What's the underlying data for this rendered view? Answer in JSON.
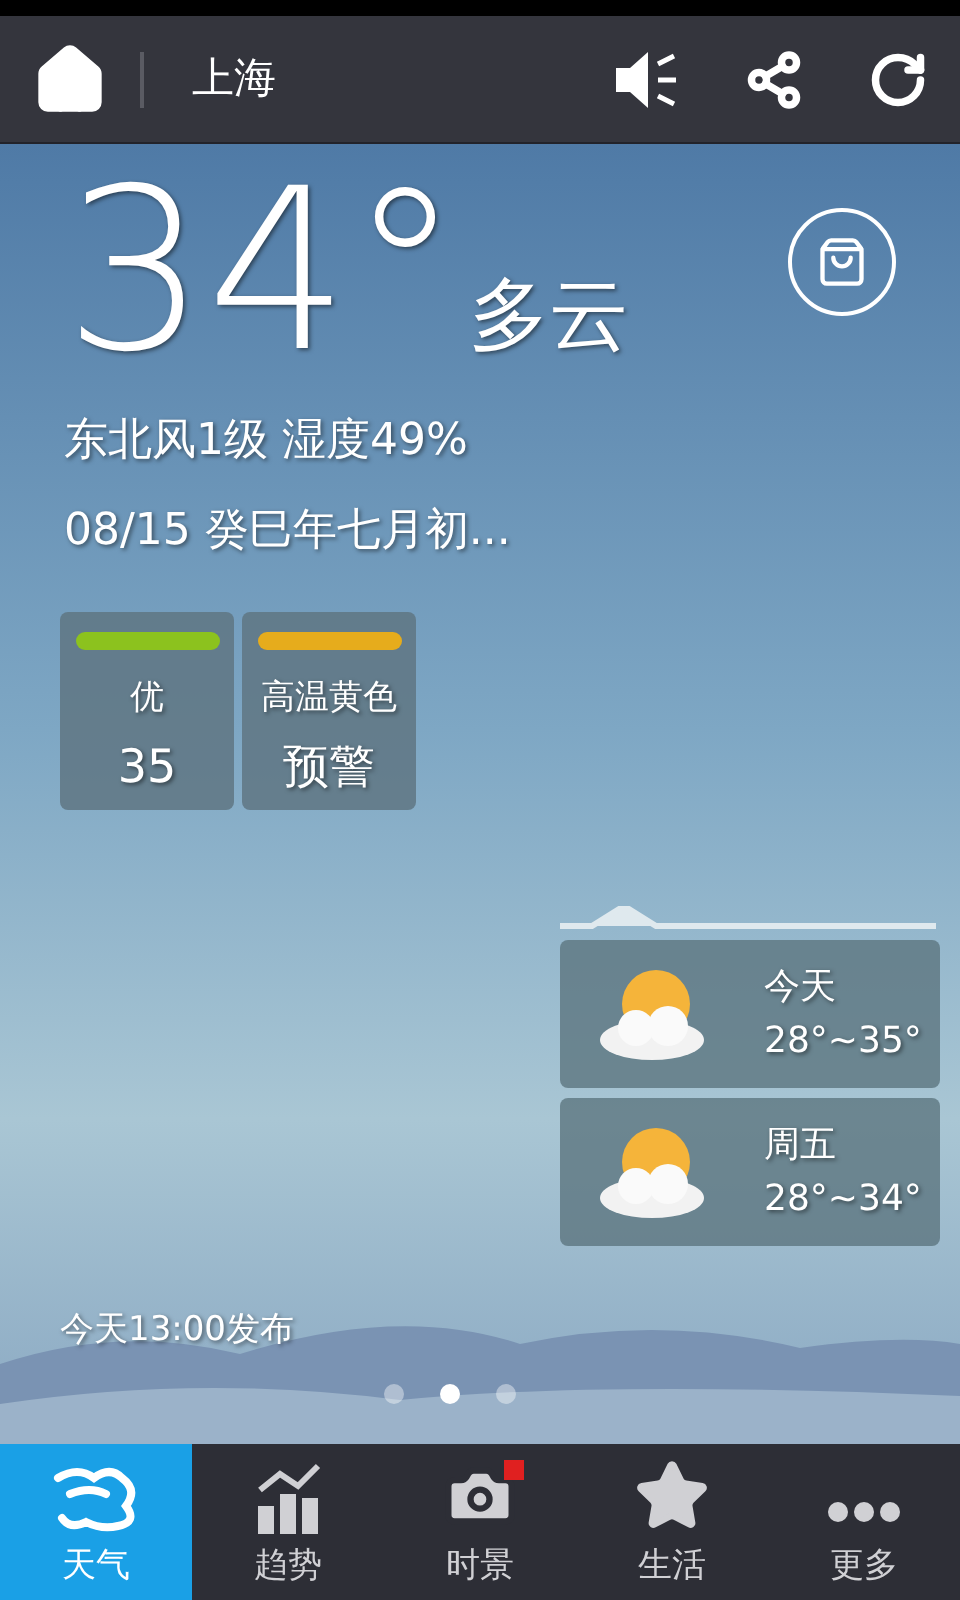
{
  "top_bar": {
    "city": "上海"
  },
  "current": {
    "temperature": "34°",
    "condition": "多云",
    "wind_humidity": "东北风1级 湿度49%",
    "date": "08/15 癸巳年七月初..."
  },
  "badges": [
    {
      "label": "优",
      "value": "35",
      "color": "#8cc21e"
    },
    {
      "label": "高温黄色",
      "value": "预警",
      "color": "#e6ac1c"
    }
  ],
  "forecast": [
    {
      "day": "今天",
      "range": "28°~35°"
    },
    {
      "day": "周五",
      "range": "28°~34°"
    }
  ],
  "published": "今天13:00发布",
  "pages": [
    {
      "selected": false
    },
    {
      "selected": true
    },
    {
      "selected": false
    }
  ],
  "nav": [
    {
      "kind": "weather",
      "label": "天气",
      "selected": true,
      "notification": false
    },
    {
      "kind": "trend",
      "label": "趋势",
      "selected": false,
      "notification": false
    },
    {
      "kind": "camera",
      "label": "时景",
      "selected": false,
      "notification": true
    },
    {
      "kind": "star",
      "label": "生活",
      "selected": false,
      "notification": false
    },
    {
      "kind": "more",
      "label": "更多",
      "selected": false,
      "notification": false
    }
  ]
}
